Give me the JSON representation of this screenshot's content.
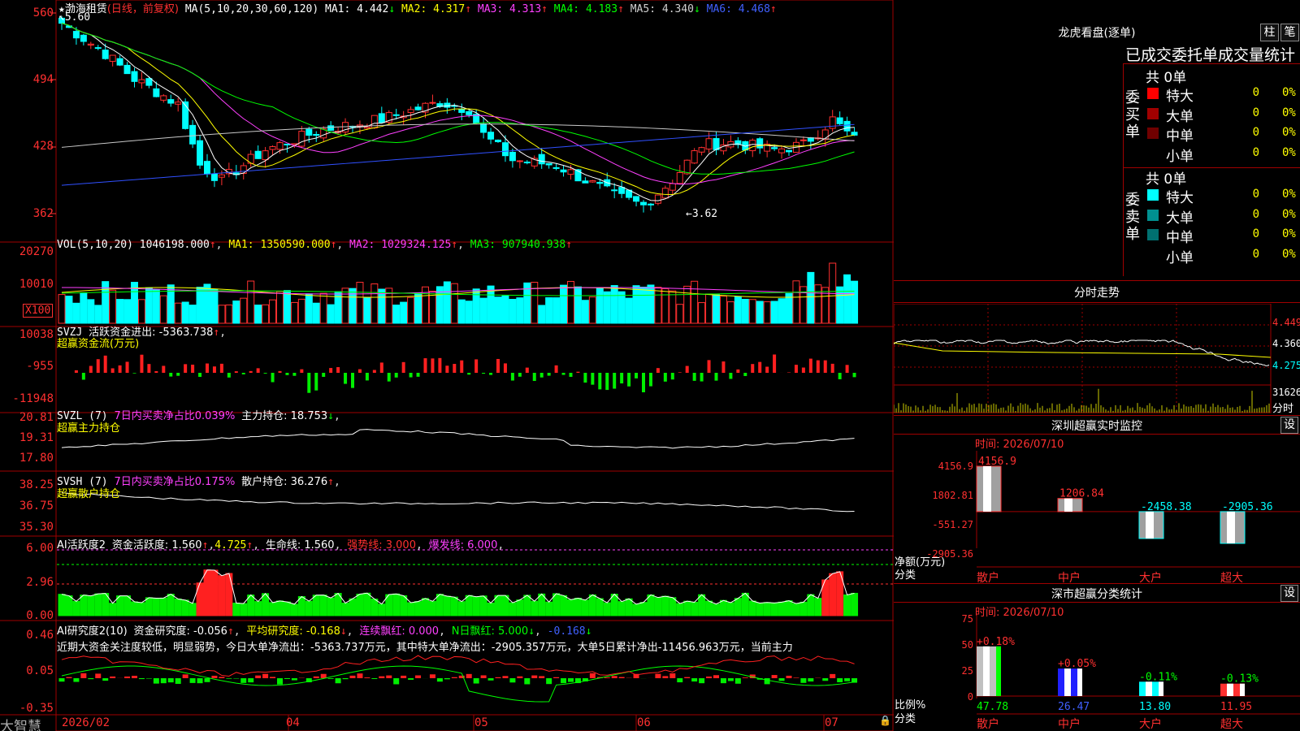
{
  "stock": {
    "name": "渤海租赁",
    "mode": "(日线，前复权)",
    "ma_label": "MA(5,10,20,30,60,120)",
    "ma": [
      {
        "label": "MA1:",
        "value": "4.442",
        "dir": "↓",
        "color": "#ffffff"
      },
      {
        "label": "MA2:",
        "value": "4.317",
        "dir": "↑",
        "color": "#ffff00"
      },
      {
        "label": "MA3:",
        "value": "4.313",
        "dir": "↑",
        "color": "#ff40ff"
      },
      {
        "label": "MA4:",
        "value": "4.183",
        "dir": "↑",
        "color": "#00ff00"
      },
      {
        "label": "MA5:",
        "value": "4.340",
        "dir": "↓",
        "color": "#d0d0d0"
      },
      {
        "label": "MA6:",
        "value": "4.468",
        "dir": "↑",
        "color": "#4060ff"
      }
    ],
    "high_mark": "5.60",
    "low_mark": "←3.62",
    "price_axis": [
      "560",
      "494",
      "428",
      "362"
    ]
  },
  "vol": {
    "label": "VOL(5,10,20)",
    "value": "1046198.000",
    "ma1": "1350590.000",
    "ma2": "1029324.125",
    "ma3": "907940.938",
    "axis": [
      "20270",
      "10010"
    ],
    "unit": "X100"
  },
  "svzj": {
    "label": "SVZJ",
    "text": "活跃资金进出: -5363.738",
    "sub": "超赢资金流(万元)",
    "axis": [
      "10038",
      "-955",
      "-11948"
    ]
  },
  "svzl": {
    "label": "SVZL (7)",
    "text1": "7日内买卖净占比0.039%",
    "text2": "主力持仓: 18.753",
    "sub": "超赢主力持仓",
    "axis": [
      "20.81",
      "19.31",
      "17.80"
    ]
  },
  "svsh": {
    "label": "SVSH (7)",
    "text1": "7日内买卖净占比0.175%",
    "text2": "散户持仓: 36.276",
    "sub": "超赢散户持仓",
    "axis": [
      "38.25",
      "36.75",
      "35.30"
    ]
  },
  "ai1": {
    "label": "AI活跃度2",
    "t1": "资金活跃度: 1.560",
    "t2": "4.725",
    "t3": "生命线: 1.560",
    "t4": "强势线: 3.000",
    "t5": "爆发线: 6.000",
    "axis": [
      "6.00",
      "2.96",
      "0.00"
    ]
  },
  "ai2": {
    "label": "AI研究度2(10)",
    "t1": "资金研究度: -0.056",
    "t2": "平均研究度: -0.168",
    "t3": "连续飘红: 0.000",
    "t4": "N日飘红: 5.000",
    "t5": "-0.168",
    "comment": "近期大资金关注度较低，明显弱势，今日大单净流出：-5363.737万元，其中特大单净流出：-2905.357万元，大单5日累计净出-11456.963万元，当前主力",
    "axis": [
      "0.46",
      "0.05",
      "-0.35"
    ]
  },
  "dates": [
    "2026/02",
    "04",
    "05",
    "06",
    "07"
  ],
  "brand": "大智慧",
  "lhb": {
    "title": "龙虎看盘(逐单)",
    "btn1": "柱",
    "btn2": "笔",
    "subtitle": "已成交委托单成交量统计",
    "buy_side": "委买单",
    "sell_side": "委卖单",
    "buy_total": "共 0单",
    "sell_total": "共 0单",
    "buy_rows": [
      {
        "label": "特大",
        "count": "0",
        "pct": "0%",
        "color": "#ff0000"
      },
      {
        "label": "大单",
        "count": "0",
        "pct": "0%",
        "color": "#a00000"
      },
      {
        "label": "中单",
        "count": "0",
        "pct": "0%",
        "color": "#700000"
      },
      {
        "label": "小单",
        "count": "0",
        "pct": "0%",
        "color": "#000000"
      }
    ],
    "sell_rows": [
      {
        "label": "特大",
        "count": "0",
        "pct": "0%",
        "color": "#00ffff"
      },
      {
        "label": "大单",
        "count": "0",
        "pct": "0%",
        "color": "#009090"
      },
      {
        "label": "中单",
        "count": "0",
        "pct": "0%",
        "color": "#007070"
      },
      {
        "label": "小单",
        "count": "0",
        "pct": "0%",
        "color": "#000000"
      }
    ]
  },
  "fenshi": {
    "title": "分时走势",
    "axis": [
      "4.449",
      "4.360",
      "4.275"
    ],
    "vol_max": "31626",
    "vol_label": "分时"
  },
  "monitor": {
    "title": "深圳超赢实时监控",
    "settings": "设",
    "time": "时间: 2026/07/10",
    "axis": [
      "4156.9",
      "1802.81",
      "-551.27",
      "-2905.36"
    ],
    "ylabel1": "净额(万元)",
    "ylabel2": "分类",
    "cats": [
      "散户",
      "中户",
      "大户",
      "超大"
    ],
    "values": [
      4156.9,
      1206.84,
      -2458.38,
      -2905.36
    ],
    "labels": [
      "4156.9",
      "1206.84",
      "-2458.38",
      "-2905.36"
    ]
  },
  "classify": {
    "title": "深市超赢分类统计",
    "settings": "设",
    "time": "时间: 2026/07/10",
    "axis": [
      "75",
      "50",
      "25",
      "0"
    ],
    "ylabel1": "比例%",
    "ylabel2": "分类",
    "cats": [
      "散户",
      "中户",
      "大户",
      "超大"
    ],
    "values": [
      47.78,
      26.47,
      13.8,
      11.95
    ],
    "labels": [
      "47.78",
      "26.47",
      "13.80",
      "11.95"
    ],
    "changes": [
      "+0.18%",
      "+0.05%",
      "-0.11%",
      "-0.13%"
    ]
  }
}
